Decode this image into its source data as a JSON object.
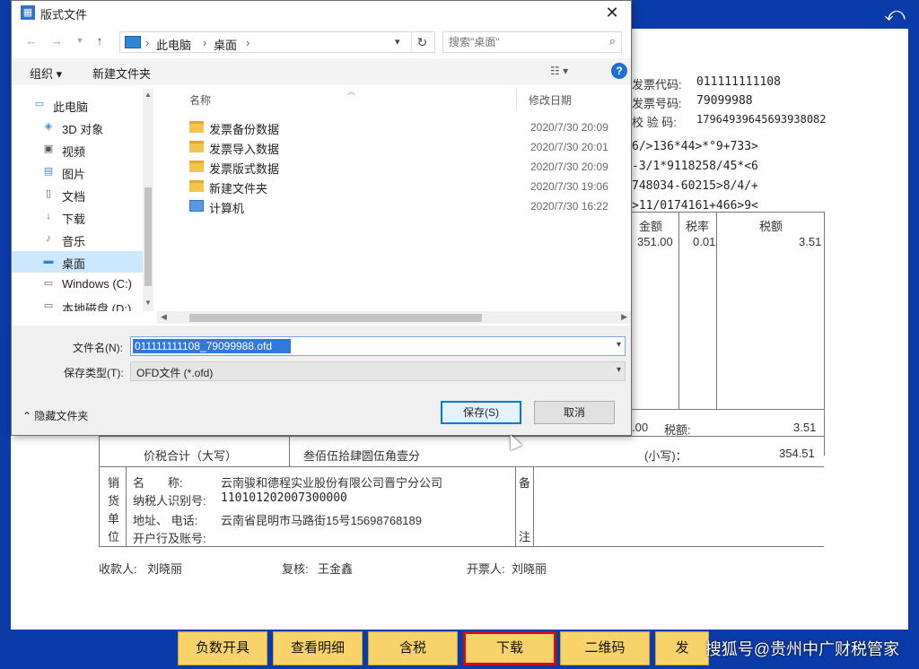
{
  "app": {
    "back_icon": "back-arrow-icon",
    "invoice": {
      "code_label": "发票代码:",
      "code_value": "011111111108",
      "number_label": "发票号码:",
      "number_value": "79099988",
      "check_label": "校 验 码:",
      "check_value": "17964939645693938082",
      "cipher_lines": [
        "6/>136*44>*°9+733>",
        "-3/1*9118258/45*<6",
        "748034-60215>8/4/+",
        ">11/0174161+466>9<"
      ],
      "col_amount": "金额",
      "col_rate": "税率",
      "col_tax": "税额",
      "row_amount": "351.00",
      "row_rate": "0.01",
      "row_tax": "3.51",
      "total_amount": ".00",
      "total_tax_label": "税额:",
      "total_tax": "3.51",
      "grand_label": "价税合计（大写）",
      "grand_words": "叁佰伍拾肆圆伍角壹分",
      "grand_small_label": "(小写)：",
      "grand_small": "354.51",
      "seller_section": [
        "销",
        "货",
        "单",
        "位"
      ],
      "seller_name_label": "名　　称:",
      "seller_name": "云南骏和德程实业股份有限公司晋宁分公司",
      "seller_tax_label": "纳税人识别号:",
      "seller_tax_id": "110101202007300000",
      "seller_addr_label": "地址、 电话:",
      "seller_addr": "云南省昆明市马路街15号15698768189",
      "seller_bank_label": "开户行及账号:",
      "remark_label": [
        "备",
        "注"
      ],
      "payee_label": "收款人:",
      "payee": "刘晓丽",
      "reviewer_label": "复核:",
      "reviewer": "王金鑫",
      "drawer_label": "开票人:",
      "drawer": "刘晓丽"
    },
    "bottom_buttons": [
      "负数开具",
      "查看明细",
      "含税",
      "下载",
      "二维码",
      "发"
    ],
    "active_button": "下载",
    "watermark": "搜狐号@贵州中广财税管家"
  },
  "dialog": {
    "title": "版式文件",
    "close_icon": "close-icon",
    "address": {
      "segments": [
        "此电脑",
        "桌面"
      ]
    },
    "search": {
      "placeholder": "搜索\"桌面\""
    },
    "toolbar": {
      "organize": "组织 ▾",
      "new_folder": "新建文件夹"
    },
    "nav_items": [
      {
        "label": "此电脑",
        "icon": "computer-icon"
      },
      {
        "label": "3D 对象",
        "icon": "cube-icon"
      },
      {
        "label": "视频",
        "icon": "video-icon"
      },
      {
        "label": "图片",
        "icon": "picture-icon"
      },
      {
        "label": "文档",
        "icon": "document-icon"
      },
      {
        "label": "下载",
        "icon": "download-icon"
      },
      {
        "label": "音乐",
        "icon": "music-icon"
      },
      {
        "label": "桌面",
        "icon": "desktop-icon"
      },
      {
        "label": "Windows (C:)",
        "icon": "drive-icon"
      },
      {
        "label": "本地磁盘 (D:)",
        "icon": "drive-icon"
      }
    ],
    "columns": {
      "name": "名称",
      "modified": "修改日期"
    },
    "files": [
      {
        "name": "发票备份数据",
        "date": "2020/7/30 20:09",
        "type": "folder"
      },
      {
        "name": "发票导入数据",
        "date": "2020/7/30 20:01",
        "type": "folder"
      },
      {
        "name": "发票版式数据",
        "date": "2020/7/30 20:09",
        "type": "folder"
      },
      {
        "name": "新建文件夹",
        "date": "2020/7/30 19:06",
        "type": "folder"
      },
      {
        "name": "计算机",
        "date": "2020/7/30 16:22",
        "type": "shortcut"
      }
    ],
    "filename_label": "文件名(N):",
    "filename_value": "011111111108_79099988.ofd",
    "filetype_label": "保存类型(T):",
    "filetype_value": "OFD文件 (*.ofd)",
    "hide_folders": "隐藏文件夹",
    "save_label": "保存(S)",
    "cancel_label": "取消"
  }
}
